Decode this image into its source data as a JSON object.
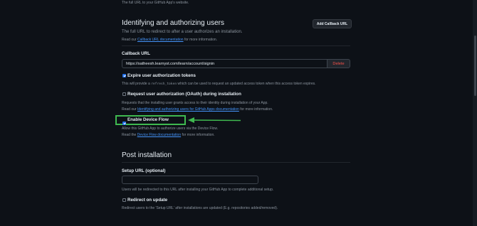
{
  "top_text": "The full URL to your GitHub App's website.",
  "section1": {
    "title": "Identifying and authorizing users",
    "subtitle": "The full URL to redirect to after a user authorizes an installation.",
    "read_prefix": "Read our",
    "doc_link": "Callback URL documentation",
    "read_suffix": "for more information.",
    "add_button": "Add Callback URL"
  },
  "callback": {
    "label": "Callback URL",
    "value": "https://satheesh.learnyst.com/learn/account/signin",
    "delete_button": "Delete"
  },
  "expire": {
    "label": "Expire user authorization tokens",
    "checked": true,
    "desc_prefix": "This will provide a",
    "desc_code": "refresh_token",
    "desc_suffix": "which can be used to request an updated access token when this access token expires."
  },
  "oauth": {
    "label": "Request user authorization (OAuth) during installation",
    "checked": false,
    "desc": "Requests that the installing user grants access to their identity during installation of your App.",
    "read_prefix": "Read our",
    "doc_link": "Identifying and authorizing users for GitHub Apps documentation",
    "read_suffix": "for more information."
  },
  "device_flow": {
    "label": "Enable Device Flow",
    "checked": true,
    "desc": "Allow this GitHub App to authorize users via the Device Flow.",
    "read_prefix": "Read the",
    "doc_link": "Device Flow documentation",
    "read_suffix": "for more information."
  },
  "post_install": {
    "title": "Post installation",
    "setup_label": "Setup URL (optional)",
    "setup_value": "",
    "setup_desc": "Users will be redirected to this URL after installing your GitHub App to complete additional setup.",
    "redirect_label": "Redirect on update",
    "redirect_checked": false,
    "redirect_desc": "Redirect users to the 'Setup URL' after installations are updated (E.g. repositories added/removed)."
  },
  "colors": {
    "background": "#0d1117",
    "link": "#4493f8",
    "highlight": "#3fb950",
    "danger": "#f85149"
  }
}
